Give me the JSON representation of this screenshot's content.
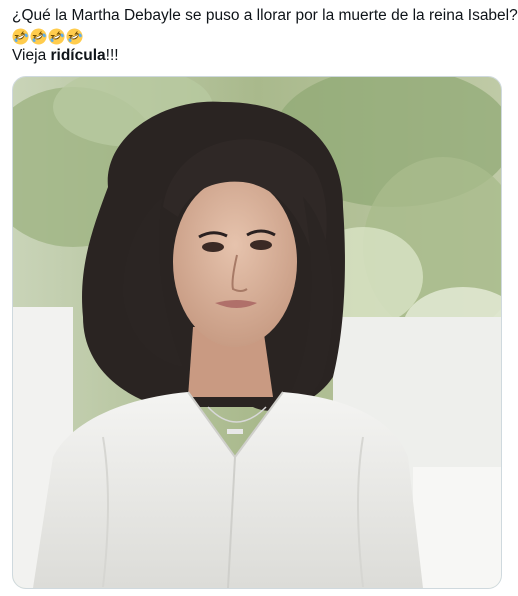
{
  "tweet": {
    "line1": "¿Qué la Martha Debayle se puso a llorar por la muerte de la reina Isabel?",
    "emojis": [
      "rolling-on-floor-laughing",
      "rolling-on-floor-laughing",
      "rolling-on-floor-laughing",
      "rolling-on-floor-laughing"
    ],
    "line3_prefix": "Vieja ",
    "line3_bold": "ridícula",
    "line3_suffix": "!!!"
  },
  "media": {
    "description_alt": ""
  },
  "colors": {
    "text": "#0f1419",
    "card_border": "#cfd9de",
    "emoji_face": "#ffcc4d"
  }
}
